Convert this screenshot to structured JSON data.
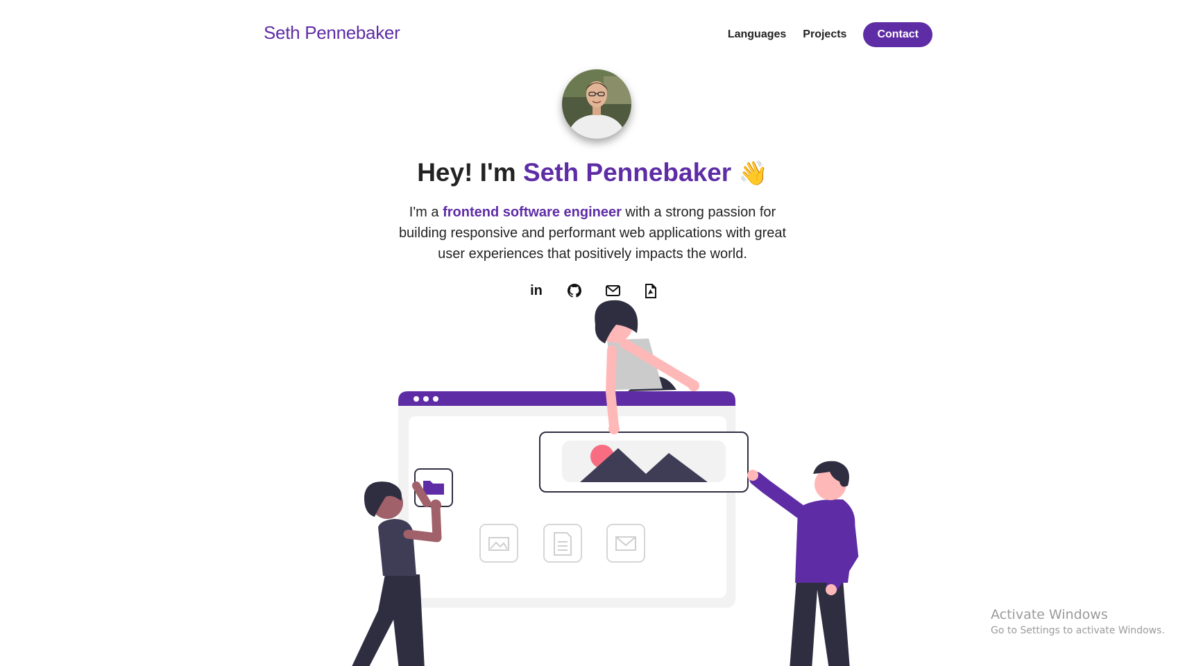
{
  "header": {
    "brand": "Seth Pennebaker",
    "nav": [
      {
        "label": "Languages"
      },
      {
        "label": "Projects"
      }
    ],
    "contact_label": "Contact"
  },
  "hero": {
    "greeting": "Hey! I'm ",
    "name": "Seth Pennebaker",
    "wave": "👋",
    "intro_before": "I'm a ",
    "intro_highlight": "frontend software engineer",
    "intro_after": " with a strong passion for building responsive and performant web applications with great user experiences that positively impacts the world."
  },
  "social": [
    {
      "icon": "linkedin-icon",
      "label": "in"
    },
    {
      "icon": "github-icon"
    },
    {
      "icon": "email-icon"
    },
    {
      "icon": "resume-pdf-icon"
    }
  ],
  "colors": {
    "accent": "#5e2ca5",
    "text": "#222222",
    "illustration_dark": "#2f2e41",
    "illustration_pink": "#f86d82",
    "illustration_skin": "#ffb8b8"
  },
  "watermark": {
    "line1": "Activate Windows",
    "line2": "Go to Settings to activate Windows."
  }
}
